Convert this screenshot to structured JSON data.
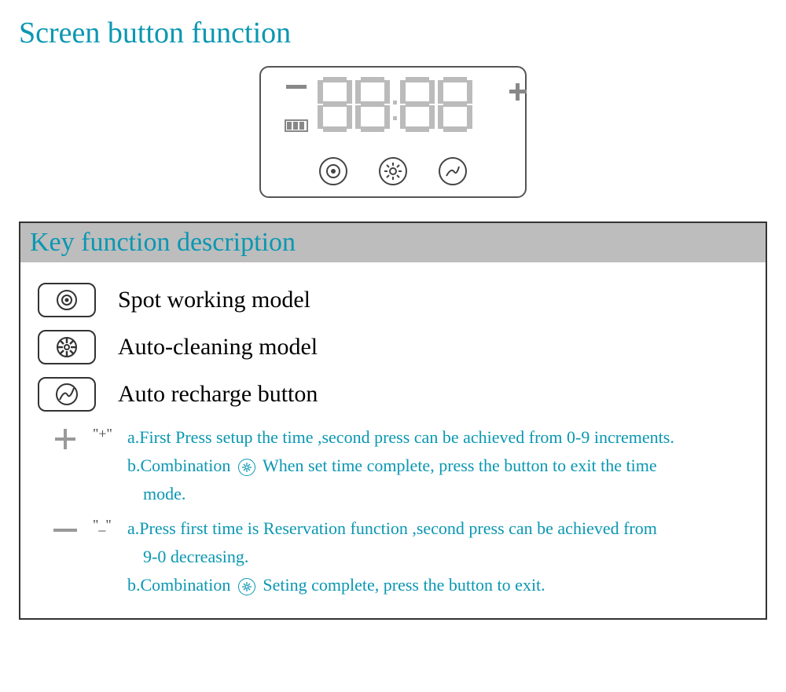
{
  "title": "Screen button function",
  "section_header": "Key function description",
  "rows": {
    "spot": "Spot working model",
    "auto_clean": "Auto-cleaning model",
    "recharge": "Auto recharge button"
  },
  "plus": {
    "symbol": "\"+\"",
    "a": "a.First Press setup the time ,second press can be achieved from 0-9 increments.",
    "b_pre": "b.Combination",
    "b_post": "When set time complete, press the button to exit the time",
    "b_tail": "mode."
  },
  "minus": {
    "symbol": "\"_\"",
    "a1": "a.Press first time is Reservation function ,second press can be achieved from",
    "a2": "9-0 decreasing.",
    "b_pre": "b.Combination",
    "b_post": "Seting complete, press the button to exit."
  }
}
